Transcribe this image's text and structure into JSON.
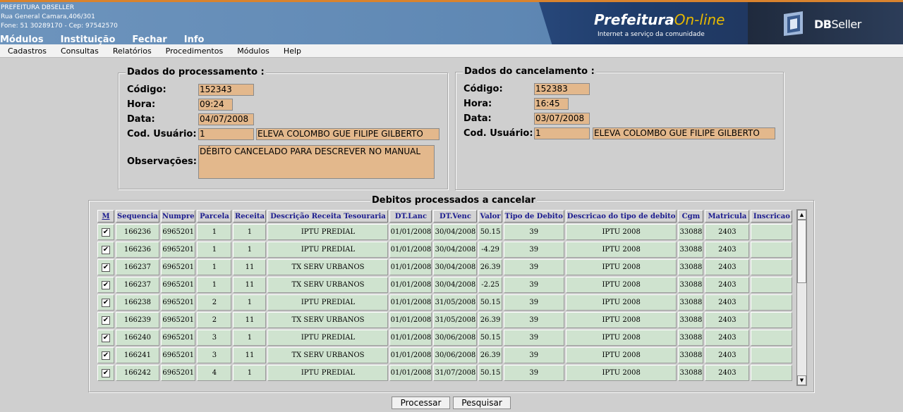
{
  "header": {
    "org_name": "PREFEITURA DBSELLER",
    "address": "Rua General Camara,406/301",
    "phone": "Fone: 51 30289170  -  Cep: 97542570",
    "top_menu": [
      "Módulos",
      "Instituição",
      "Fechar",
      "Info"
    ],
    "banner_title_1": "Prefeitura",
    "banner_title_2": "On-line",
    "banner_subtitle": "Internet a serviço da comunidade",
    "brand_db": "DB",
    "brand_seller": "Seller"
  },
  "menubar": [
    "Cadastros",
    "Consultas",
    "Relatórios",
    "Procedimentos",
    "Módulos",
    "Help"
  ],
  "processamento": {
    "title": "Dados do processamento :",
    "codigo_label": "Código:",
    "codigo": "152343",
    "hora_label": "Hora:",
    "hora": "09:24",
    "data_label": "Data:",
    "data": "04/07/2008",
    "usuario_label": "Cod. Usuário:",
    "usuario_cod": "1",
    "usuario_nome": "ELEVA COLOMBO GUE FILIPE GILBERTO",
    "obs_label": "Observações:",
    "obs": "DÉBITO CANCELADO PARA DESCREVER NO MANUAL"
  },
  "cancelamento": {
    "title": "Dados do cancelamento :",
    "codigo_label": "Código:",
    "codigo": "152383",
    "hora_label": "Hora:",
    "hora": "16:45",
    "data_label": "Data:",
    "data": "03/07/2008",
    "usuario_label": "Cod. Usuário:",
    "usuario_cod": "1",
    "usuario_nome": "ELEVA COLOMBO GUE FILIPE GILBERTO"
  },
  "grid": {
    "title": "Debitos processados a cancelar",
    "columns": [
      "M",
      "Sequencia",
      "Numpre",
      "Parcela",
      "Receita",
      "Descrição Receita Tesouraria",
      "DT.Lanc",
      "DT.Venc",
      "Valor",
      "Tipo de Debito",
      "Descricao do tipo de debito",
      "Cgm",
      "Matricula",
      "Inscricao"
    ],
    "rows": [
      [
        "166236",
        "6965201",
        "1",
        "1",
        "IPTU PREDIAL",
        "01/01/2008",
        "30/04/2008",
        "50.15",
        "39",
        "IPTU 2008",
        "33088",
        "2403",
        ""
      ],
      [
        "166236",
        "6965201",
        "1",
        "1",
        "IPTU PREDIAL",
        "01/01/2008",
        "30/04/2008",
        "-4.29",
        "39",
        "IPTU 2008",
        "33088",
        "2403",
        ""
      ],
      [
        "166237",
        "6965201",
        "1",
        "11",
        "TX SERV URBANOS",
        "01/01/2008",
        "30/04/2008",
        "26.39",
        "39",
        "IPTU 2008",
        "33088",
        "2403",
        ""
      ],
      [
        "166237",
        "6965201",
        "1",
        "11",
        "TX SERV URBANOS",
        "01/01/2008",
        "30/04/2008",
        "-2.25",
        "39",
        "IPTU 2008",
        "33088",
        "2403",
        ""
      ],
      [
        "166238",
        "6965201",
        "2",
        "1",
        "IPTU PREDIAL",
        "01/01/2008",
        "31/05/2008",
        "50.15",
        "39",
        "IPTU 2008",
        "33088",
        "2403",
        ""
      ],
      [
        "166239",
        "6965201",
        "2",
        "11",
        "TX SERV URBANOS",
        "01/01/2008",
        "31/05/2008",
        "26.39",
        "39",
        "IPTU 2008",
        "33088",
        "2403",
        ""
      ],
      [
        "166240",
        "6965201",
        "3",
        "1",
        "IPTU PREDIAL",
        "01/01/2008",
        "30/06/2008",
        "50.15",
        "39",
        "IPTU 2008",
        "33088",
        "2403",
        ""
      ],
      [
        "166241",
        "6965201",
        "3",
        "11",
        "TX SERV URBANOS",
        "01/01/2008",
        "30/06/2008",
        "26.39",
        "39",
        "IPTU 2008",
        "33088",
        "2403",
        ""
      ],
      [
        "166242",
        "6965201",
        "4",
        "1",
        "IPTU PREDIAL",
        "01/01/2008",
        "31/07/2008",
        "50.15",
        "39",
        "IPTU 2008",
        "33088",
        "2403",
        ""
      ]
    ],
    "checkmark": "✔"
  },
  "buttons": {
    "processar": "Processar",
    "pesquisar": "Pesquisar"
  },
  "colors": {
    "field_bg": "#e3b88c",
    "cell_bg": "#cfe3cf",
    "header_text": "#1a1a8e",
    "page_bg": "#cfcfcf"
  }
}
